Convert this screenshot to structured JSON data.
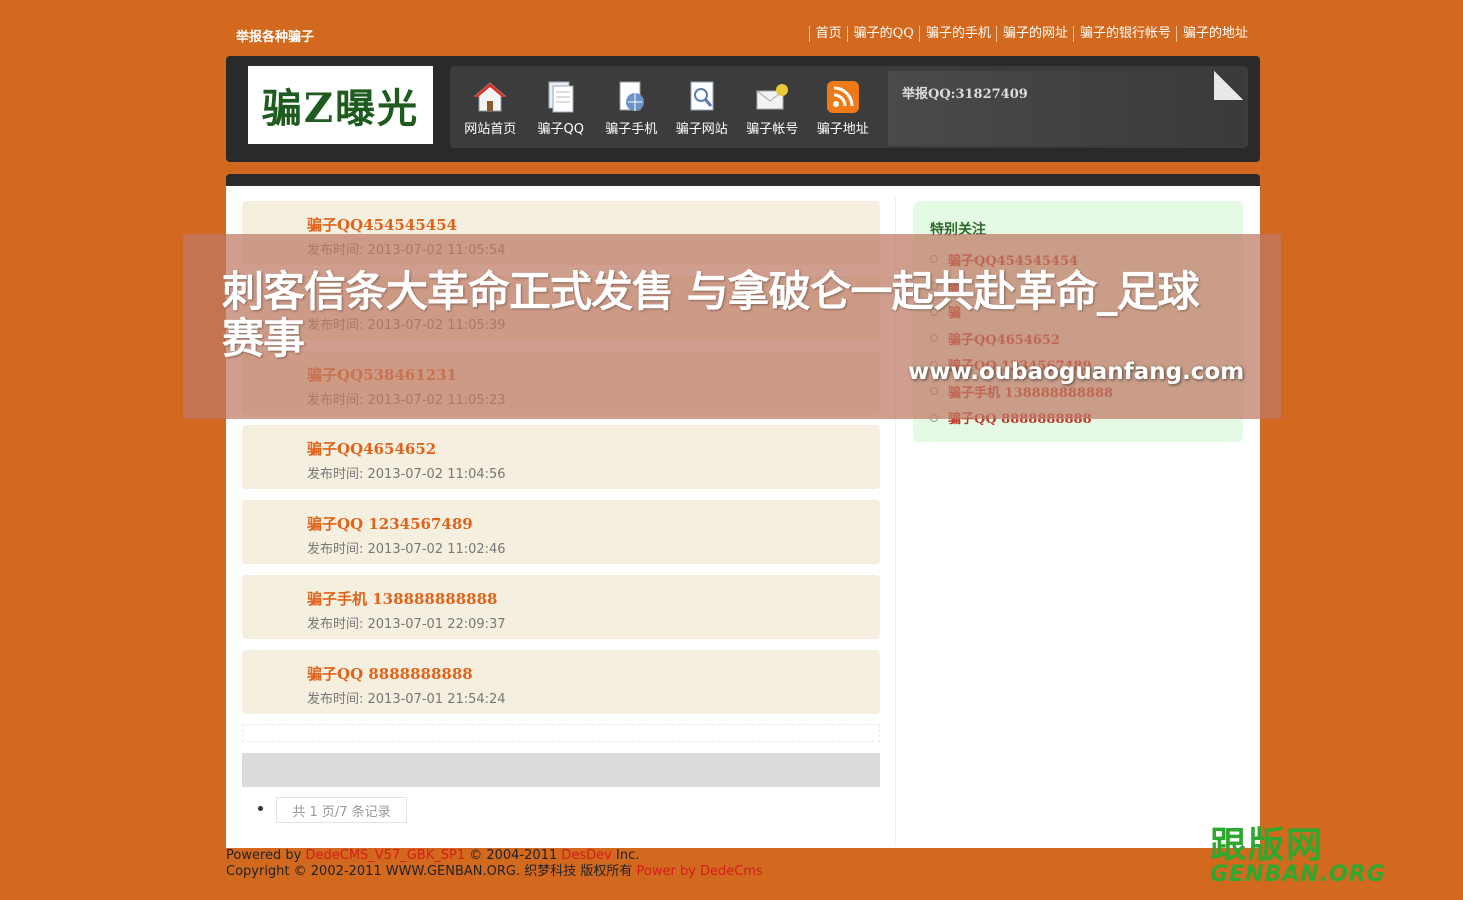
{
  "site": {
    "title": "举报各种骗子",
    "logo_text": "骗Z曝光"
  },
  "topnav": [
    "首页",
    "骗子的QQ",
    "骗子的手机",
    "骗子的网址",
    "骗子的银行帐号",
    "骗子的地址"
  ],
  "nav": [
    {
      "label": "网站首页",
      "icon": "home-icon",
      "color": "#d9322b"
    },
    {
      "label": "骗子QQ",
      "icon": "document-icon",
      "color": "#9aa7b4"
    },
    {
      "label": "骗子手机",
      "icon": "globe-document-icon",
      "color": "#6b93c9"
    },
    {
      "label": "骗子网站",
      "icon": "magnifier-document-icon",
      "color": "#8fa2b8"
    },
    {
      "label": "骗子帐号",
      "icon": "mail-icon",
      "color": "#e8c93a"
    },
    {
      "label": "骗子地址",
      "icon": "rss-icon",
      "color": "#f07a18"
    }
  ],
  "report": {
    "text": "举报QQ:31827409"
  },
  "articles": [
    {
      "title": "骗子QQ454545454",
      "date": "发布时间: 2013-07-02 11:05:54"
    },
    {
      "title": "",
      "date": "发布时间: 2013-07-02 11:05:39"
    },
    {
      "title": "骗子QQ538461231",
      "date": "发布时间: 2013-07-02 11:05:23"
    },
    {
      "title": "骗子QQ4654652",
      "date": "发布时间: 2013-07-02 11:04:56"
    },
    {
      "title": "骗子QQ 1234567489",
      "date": "发布时间: 2013-07-02 11:02:46"
    },
    {
      "title": "骗子手机 138888888888",
      "date": "发布时间: 2013-07-01 22:09:37"
    },
    {
      "title": "骗子QQ 8888888888",
      "date": "发布时间: 2013-07-01 21:54:24"
    }
  ],
  "sidebar": {
    "title": "特别关注",
    "items": [
      "骗子QQ454545454",
      "骗",
      "骗",
      "骗子QQ4654652",
      "骗子QQ 1234567489",
      "骗子手机 138888888888",
      "骗子QQ 8888888888"
    ]
  },
  "pager": {
    "text": "共 1 页/7 条记录"
  },
  "footer": {
    "powered_prefix": "Powered by ",
    "powered_link": "DedeCMS_V57_GBK_SP1",
    "powered_mid": " © 2004-2011 ",
    "powered_link2": "DesDev",
    "powered_suffix": " Inc.",
    "copyright": "Copyright © 2002-2011 WWW.GENBAN.ORG. 织梦科技 版权所有 ",
    "copyright_link": "Power by DedeCms"
  },
  "overlay": {
    "title": "刺客信条大革命正式发售 与拿破仑一起共赴革命_足球赛事",
    "url": "www.oubaoguanfang.com"
  },
  "watermark": {
    "line1": "跟版网",
    "line2": "GENBAN.ORG"
  }
}
